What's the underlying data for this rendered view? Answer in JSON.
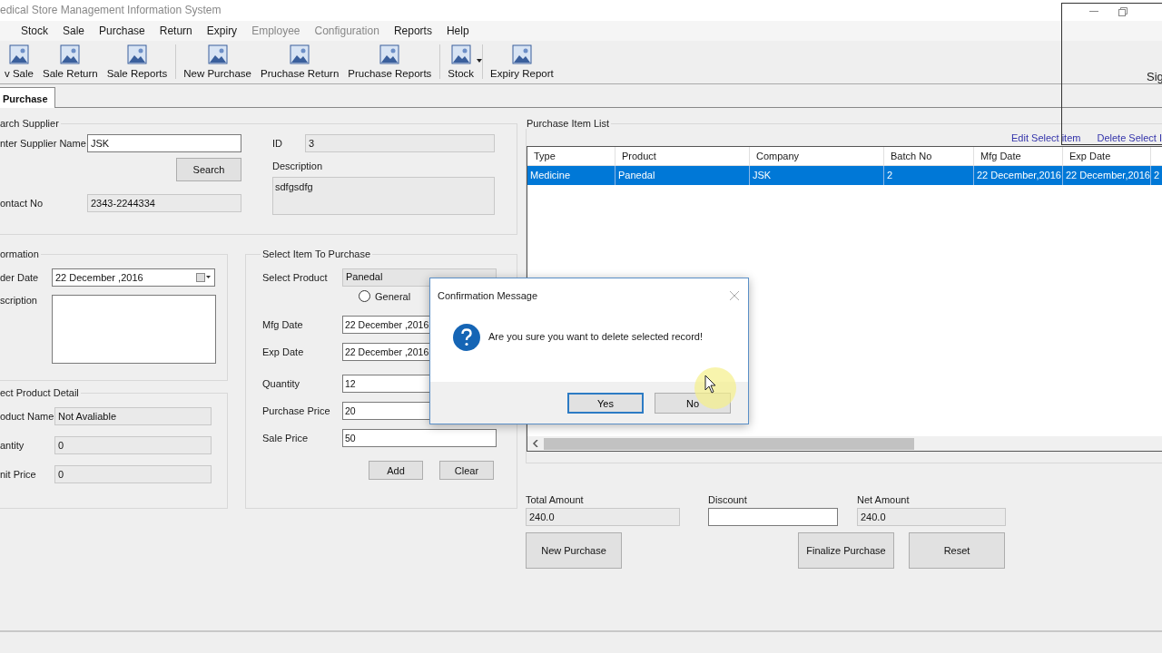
{
  "window": {
    "title": "edical Store Management Information System"
  },
  "menu": [
    {
      "label": "Stock",
      "disabled": false
    },
    {
      "label": "Sale",
      "disabled": false
    },
    {
      "label": "Purchase",
      "disabled": false
    },
    {
      "label": "Return",
      "disabled": false
    },
    {
      "label": "Expiry",
      "disabled": false
    },
    {
      "label": "Employee",
      "disabled": true
    },
    {
      "label": "Configuration",
      "disabled": true
    },
    {
      "label": "Reports",
      "disabled": false
    },
    {
      "label": "Help",
      "disabled": false
    }
  ],
  "toolbar": [
    {
      "label": "v Sale",
      "separator_before": false,
      "dropdown": false
    },
    {
      "label": "Sale Return",
      "separator_before": false,
      "dropdown": false
    },
    {
      "label": "Sale Reports",
      "separator_before": false,
      "dropdown": false
    },
    {
      "label": "New Purchase",
      "separator_before": true,
      "dropdown": false
    },
    {
      "label": "Pruchase Return",
      "separator_before": false,
      "dropdown": false
    },
    {
      "label": "Pruchase Reports",
      "separator_before": false,
      "dropdown": false
    },
    {
      "label": "Stock",
      "separator_before": true,
      "dropdown": true
    },
    {
      "label": "Expiry Report",
      "separator_before": true,
      "dropdown": false
    }
  ],
  "tabs": [
    {
      "label": "Purchase",
      "selected": true
    }
  ],
  "search_supplier": {
    "title": "arch Supplier",
    "name_label": "nter Supplier Name",
    "name_value": "JSK",
    "search_button": "Search",
    "contact_label": "ontact No",
    "contact_value": "2343-2244334",
    "id_label": "ID",
    "id_value": "3",
    "description_label": "Description",
    "description_value": "sdfgsdfg"
  },
  "information": {
    "title": "ormation",
    "order_date_label": "der Date",
    "order_date_value": "22 December ,2016",
    "description_label": "scription"
  },
  "product_detail": {
    "title": "ect Product Detail",
    "fields": [
      {
        "label": "oduct Name",
        "value": "Not Avaliable"
      },
      {
        "label": "antity",
        "value": "0"
      },
      {
        "label": "nit Price",
        "value": "0"
      }
    ]
  },
  "select_item": {
    "title": "Select Item To Purchase",
    "product_label": "Select Product",
    "product_value": "Panedal",
    "radio": {
      "label": "General",
      "checked": false
    },
    "fields": [
      {
        "label": "Mfg Date",
        "value": "22 December ,2016"
      },
      {
        "label": "Exp Date",
        "value": "22 December ,2016"
      },
      {
        "label": "Quantity",
        "value": "12"
      },
      {
        "label": "Purchase Price",
        "value": "20"
      },
      {
        "label": "Sale Price",
        "value": "50"
      }
    ],
    "buttons": [
      "Add",
      "Clear"
    ]
  },
  "item_list": {
    "title": "Purchase Item List",
    "links": [
      "Edit Select item",
      "Delete Select I"
    ],
    "columns": [
      "Type",
      "Product",
      "Company",
      "Batch No",
      "Mfg Date",
      "Exp Date"
    ],
    "rows": [
      {
        "selected": true,
        "cells": [
          "Medicine",
          "Panedal",
          "JSK",
          "2",
          "22 December,2016",
          "22 December,2016",
          "2"
        ]
      }
    ]
  },
  "totals": [
    {
      "label": "Total Amount",
      "value": "240.0",
      "readonly": true
    },
    {
      "label": "Discount",
      "readonly": false
    },
    {
      "label": "Net Amount",
      "value": "240.0",
      "readonly": true
    }
  ],
  "actions": [
    "New Purchase",
    "Finalize Purchase",
    "Reset"
  ],
  "dialog": {
    "title": "Confirmation Message",
    "message": "Are you sure you want to delete selected record!",
    "buttons": [
      {
        "label": "Yes",
        "selected": true
      },
      {
        "label": "No",
        "selected": false
      }
    ]
  },
  "side_window": {
    "text": "Sig"
  }
}
